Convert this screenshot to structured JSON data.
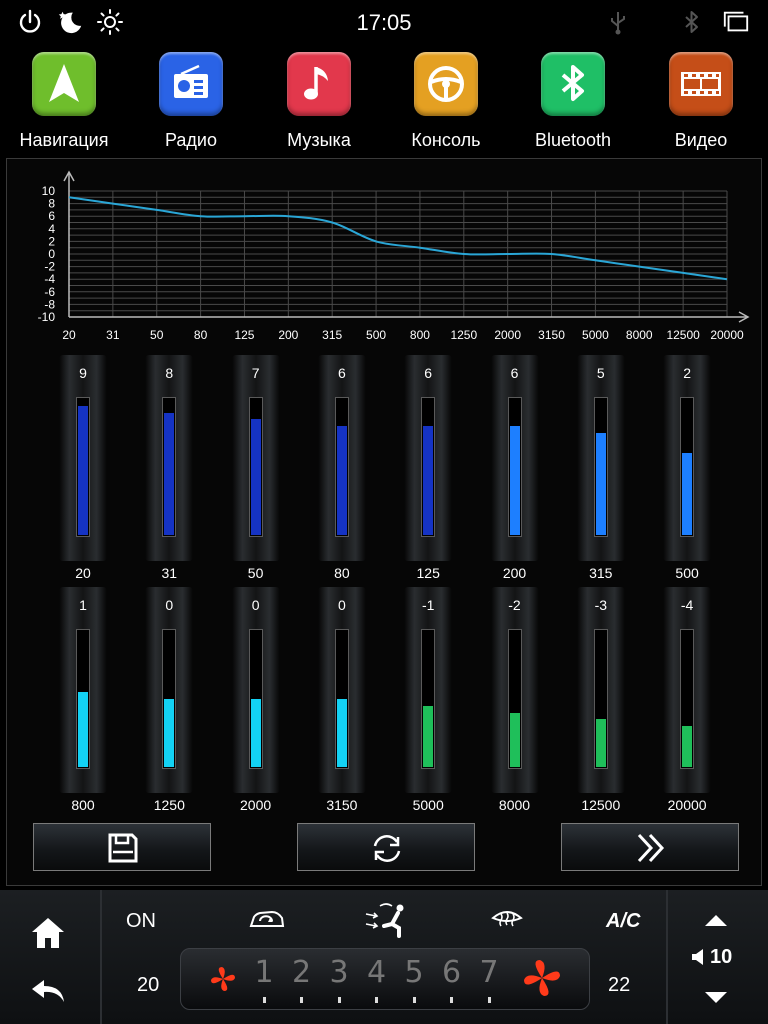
{
  "status": {
    "time": "17:05",
    "icons": [
      "power-icon",
      "night-mode-icon",
      "brightness-icon",
      "usb-icon",
      "bluetooth-icon",
      "windows-icon"
    ]
  },
  "apps": [
    {
      "label": "Навигация",
      "icon": "navigation-arrow-icon",
      "color": "#6fbe2c"
    },
    {
      "label": "Радио",
      "icon": "radio-icon",
      "color": "#2a63e6"
    },
    {
      "label": "Музыка",
      "icon": "music-note-icon",
      "color": "#e2384c"
    },
    {
      "label": "Консоль",
      "icon": "steering-wheel-icon",
      "color": "#e4a022"
    },
    {
      "label": "Bluetooth",
      "icon": "bluetooth-icon",
      "color": "#1fbf66"
    },
    {
      "label": "Видео",
      "icon": "film-icon",
      "color": "#c54e18"
    }
  ],
  "equalizer": {
    "y_ticks": [
      "10",
      "8",
      "6",
      "4",
      "2",
      "0",
      "-2",
      "-4",
      "-6",
      "-8",
      "-10"
    ],
    "x_ticks": [
      "20",
      "31",
      "50",
      "80",
      "125",
      "200",
      "315",
      "500",
      "800",
      "1250",
      "2000",
      "3150",
      "5000",
      "8000",
      "12500",
      "20000"
    ],
    "curve_color": "#2aa6d6",
    "bands": [
      {
        "freq": "20",
        "value": "9",
        "level": 9,
        "color": "#1533c4"
      },
      {
        "freq": "31",
        "value": "8",
        "level": 8,
        "color": "#1533c4"
      },
      {
        "freq": "50",
        "value": "7",
        "level": 7,
        "color": "#1533c4"
      },
      {
        "freq": "80",
        "value": "6",
        "level": 6,
        "color": "#1533c4"
      },
      {
        "freq": "125",
        "value": "6",
        "level": 6,
        "color": "#1533c4"
      },
      {
        "freq": "200",
        "value": "6",
        "level": 6,
        "color": "#1d7fff"
      },
      {
        "freq": "315",
        "value": "5",
        "level": 5,
        "color": "#1d7fff"
      },
      {
        "freq": "500",
        "value": "2",
        "level": 2,
        "color": "#1d7fff"
      },
      {
        "freq": "800",
        "value": "1",
        "level": 1,
        "color": "#13d2f4"
      },
      {
        "freq": "1250",
        "value": "0",
        "level": 0,
        "color": "#13d2f4"
      },
      {
        "freq": "2000",
        "value": "0",
        "level": 0,
        "color": "#13d2f4"
      },
      {
        "freq": "3150",
        "value": "0",
        "level": 0,
        "color": "#13d2f4"
      },
      {
        "freq": "5000",
        "value": "-1",
        "level": -1,
        "color": "#1fbf5a"
      },
      {
        "freq": "8000",
        "value": "-2",
        "level": -2,
        "color": "#1fbf5a"
      },
      {
        "freq": "12500",
        "value": "-3",
        "level": -3,
        "color": "#1fbf5a"
      },
      {
        "freq": "20000",
        "value": "-4",
        "level": -4,
        "color": "#1fbf5a"
      }
    ],
    "buttons": [
      "save-icon",
      "reset-icon",
      "next-icon"
    ]
  },
  "climate": {
    "on_label": "ON",
    "ac_label": "A/C",
    "left_temp": "20",
    "right_temp": "22",
    "fan_levels": [
      "1",
      "2",
      "3",
      "4",
      "5",
      "6",
      "7"
    ],
    "volume": "10",
    "fan_color": "#ff3a1a"
  }
}
